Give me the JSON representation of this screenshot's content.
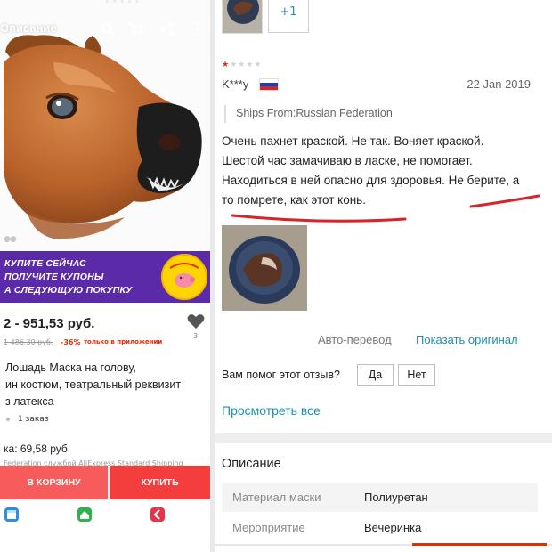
{
  "left_panel": {
    "topbar": {
      "title": "Описание",
      "icons": [
        "search-icon",
        "cart-icon",
        "share-icon",
        "more-icon"
      ]
    },
    "product_image": {
      "subject": "horse-head-mask"
    },
    "promo": {
      "line1": "КУПИТЕ СЕЙЧАС",
      "line2": "ПОЛУЧИТЕ КУПОНЫ",
      "line3": "А СЛЕДУЮЩУЮ ПОКУПКУ",
      "badge_color": "#ffd400",
      "bg_color": "#5a2aa8"
    },
    "price": "2 - 951,53 руб.",
    "old_price": "1 486,30 руб.",
    "discount": "-36%",
    "app_only": "только в приложении",
    "wishlist_count": "3",
    "title_lines": [
      "Лошадь Маска на голову,",
      "ин костюм, театральный реквизит",
      "з латекса"
    ],
    "orders": "1 заказ",
    "shipping": "ка: 69,58 руб.",
    "shipping_note": "Federation службой AliExpress Standard Shipping",
    "cart_button": "В КОРЗИНУ",
    "buy_button": "КУПИТЬ",
    "nav_icons": [
      "store-icon",
      "home-icon",
      "back-icon"
    ]
  },
  "right_panel": {
    "extra_photos_label": "+1",
    "rating": 1,
    "rating_max": 5,
    "reviewer": "K***y",
    "country_flag": "flag-russia-icon",
    "date": "22 Jan 2019",
    "ships_from": "Ships From:Russian Federation",
    "review_lines": [
      "Очень пахнет краской. Не так. Воняет краской.",
      "Шестой час замачиваю в ласке, не помогает.",
      "Находиться в ней опасно для здоровья. Не берите, а",
      "то помрете, как этот конь."
    ],
    "auto_translate": "Авто-перевод",
    "show_original": "Показать оригинал",
    "helpful_question": "Вам помог этот отзыв?",
    "yes": "Да",
    "no": "Нет",
    "see_all": "Просмотреть все",
    "description_title": "Описание",
    "specs": [
      {
        "key": "Материал маски",
        "value": "Полиуретан"
      },
      {
        "key": "Мероприятие",
        "value": "Вечеринка"
      }
    ]
  },
  "colors": {
    "accent_red": "#e62e04",
    "link_blue": "#1e8eaf",
    "annotation_red": "#d8232a"
  }
}
